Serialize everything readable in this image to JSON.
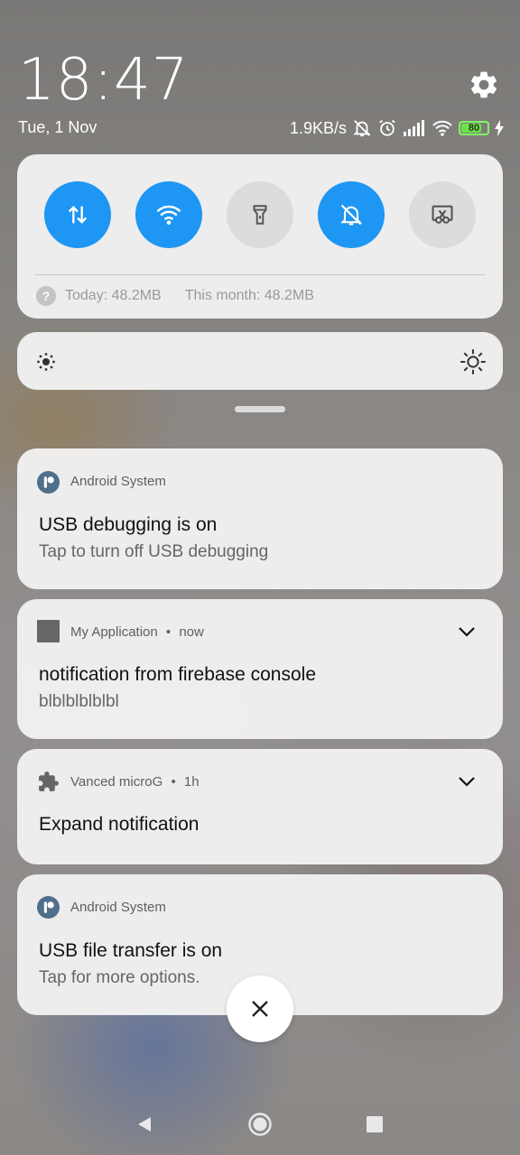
{
  "status": {
    "time": "18:47",
    "date": "Tue, 1 Nov",
    "net_speed": "1.9KB/s",
    "battery": 80,
    "battery_label": "80"
  },
  "quick_settings": {
    "toggles": [
      {
        "name": "mobile-data",
        "state": "on"
      },
      {
        "name": "wifi",
        "state": "on"
      },
      {
        "name": "flashlight",
        "state": "off"
      },
      {
        "name": "silent",
        "state": "on"
      },
      {
        "name": "screenshot",
        "state": "off"
      }
    ],
    "usage_today": "Today: 48.2MB",
    "usage_month": "This month: 48.2MB",
    "accent": "#1e96f3"
  },
  "notifications": [
    {
      "app": "Android System",
      "title": "USB debugging is on",
      "text": "Tap to turn off USB debugging",
      "icon": "android-system-icon"
    },
    {
      "app": "My Application",
      "meta": "now",
      "title": "notification from firebase console",
      "text": "blblblblblbl",
      "icon": "app-square-icon"
    },
    {
      "app": "Vanced microG",
      "meta": "1h",
      "title": "Expand notification",
      "icon": "puzzle-icon"
    },
    {
      "app": "Android System",
      "title": "USB file transfer is on",
      "text": "Tap for more options.",
      "icon": "android-system-icon"
    }
  ],
  "separator": "•"
}
